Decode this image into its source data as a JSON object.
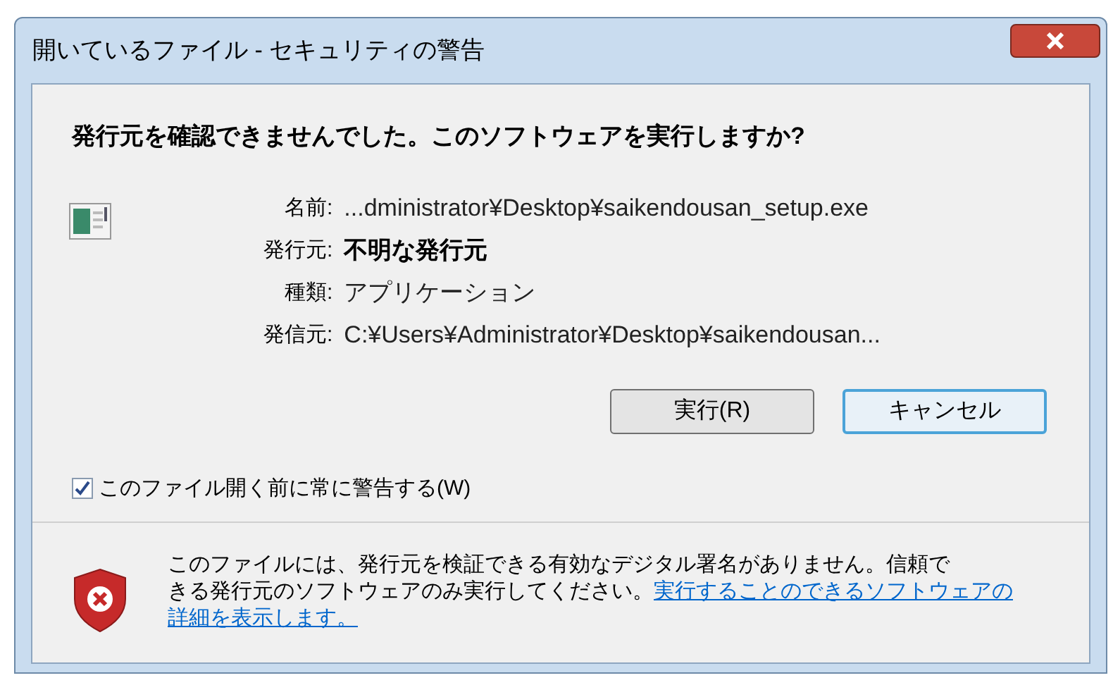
{
  "window": {
    "title": "開いているファイル - セキュリティの警告"
  },
  "heading": "発行元を確認できませんでした。このソフトウェアを実行しますか?",
  "details": [
    {
      "label": "名前:",
      "value": "...dministrator¥Desktop¥saikendousan_setup.exe",
      "bold": false
    },
    {
      "label": "発行元:",
      "value": "不明な発行元",
      "bold": true
    },
    {
      "label": "種類:",
      "value": "アプリケーション",
      "bold": false
    },
    {
      "label": "発信元:",
      "value": "C:¥Users¥Administrator¥Desktop¥saikendousan...",
      "bold": false
    }
  ],
  "buttons": [
    {
      "label": "実行(R)",
      "focused": false
    },
    {
      "label": "キャンセル",
      "focused": true
    }
  ],
  "checkbox": {
    "label": "このファイル開く前に常に警告する(W)",
    "checked": true
  },
  "footer": {
    "lines": [
      [
        {
          "kind": "text",
          "text": "このファイルには、発行元を検証できる有効なデジタル署名がありません。信頼で"
        }
      ],
      [
        {
          "kind": "text",
          "text": "きる発行元のソフトウェアのみ実行してください。"
        },
        {
          "kind": "link",
          "text": "実行することのできるソフトウェアの"
        }
      ],
      [
        {
          "kind": "link",
          "text": "詳細を表示します。"
        }
      ]
    ]
  }
}
